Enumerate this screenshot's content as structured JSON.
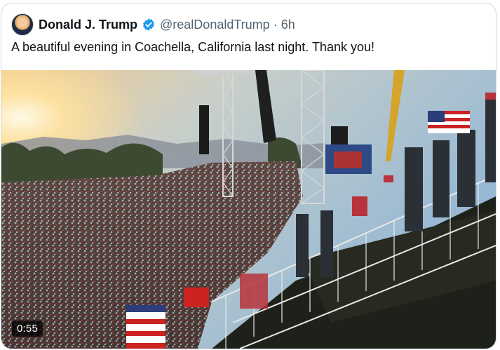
{
  "tweet": {
    "author_name": "Donald J. Trump",
    "handle": "@realDonaldTrump",
    "separator": "·",
    "time": "6h",
    "text": "A beautiful evening in Coachella, California last night. Thank you!"
  },
  "media": {
    "type": "video",
    "duration": "0:55"
  },
  "colors": {
    "verified_blue": "#1d9bf0",
    "text_primary": "#0f1419",
    "text_secondary": "#536471",
    "border": "#cfd9de"
  }
}
